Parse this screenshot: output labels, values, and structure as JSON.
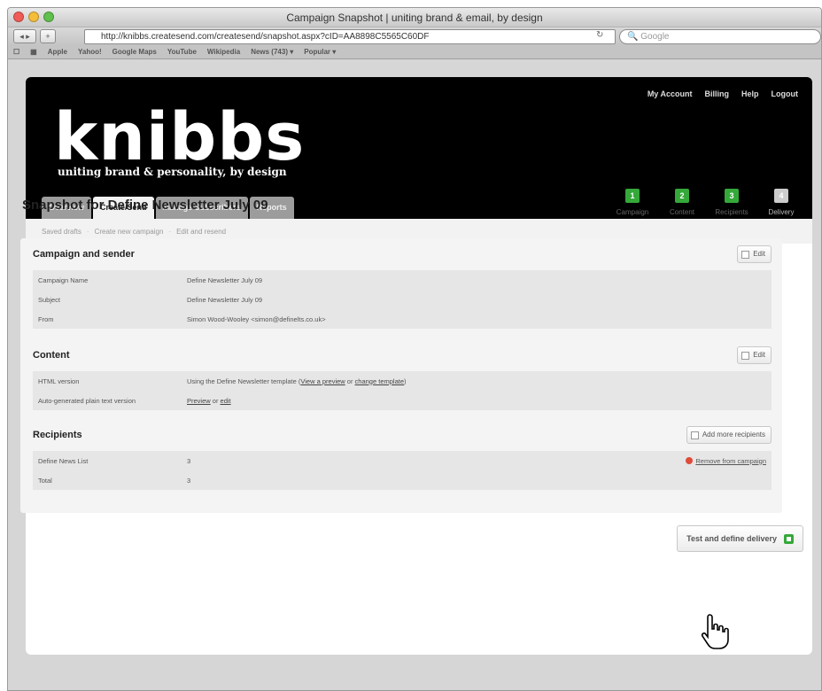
{
  "browser": {
    "window_title": "Campaign Snapshot | uniting brand & email, by design",
    "url": "http://knibbs.createsend.com/createsend/snapshot.aspx?cID=AA8898C5565C60DF",
    "search_placeholder": "Google",
    "bookmarks": [
      "Apple",
      "Yahoo!",
      "Google Maps",
      "YouTube",
      "Wikipedia",
      "News (743) ▾",
      "Popular ▾"
    ]
  },
  "header": {
    "logo": "knibbs",
    "tagline": "uniting brand & personality, by design",
    "links": [
      "My Account",
      "Billing",
      "Help",
      "Logout"
    ],
    "tabs": [
      {
        "label": "Overview",
        "active": false
      },
      {
        "label": "Create/Send",
        "active": true
      },
      {
        "label": "Manage Subscribers",
        "active": false
      },
      {
        "label": "Reports",
        "active": false
      }
    ]
  },
  "breadcrumb": [
    "Saved drafts",
    "Create new campaign",
    "Edit and resend"
  ],
  "page_title": "Snapshot for Define Newsletter July 09",
  "steps": [
    {
      "num": "1",
      "label": "Campaign",
      "done": true
    },
    {
      "num": "2",
      "label": "Content",
      "done": true
    },
    {
      "num": "3",
      "label": "Recipients",
      "done": true
    },
    {
      "num": "4",
      "label": "Delivery",
      "done": false
    }
  ],
  "campaign_section": {
    "title": "Campaign and sender",
    "edit_label": "Edit",
    "rows": [
      {
        "k": "Campaign Name",
        "v": "Define Newsletter July 09"
      },
      {
        "k": "Subject",
        "v": "Define Newsletter July 09"
      },
      {
        "k": "From",
        "v": "Simon Wood-Wooley <simon@definelts.co.uk>"
      }
    ]
  },
  "content_section": {
    "title": "Content",
    "edit_label": "Edit",
    "html_label": "HTML version",
    "html_text": "Using the Define Newsletter template (",
    "html_link1": "View a preview",
    "html_or": " or ",
    "html_link2": "change template",
    "html_close": ")",
    "plain_label": "Auto-generated plain text version",
    "plain_link1": "Preview",
    "plain_or": " or ",
    "plain_link2": "edit"
  },
  "recipients_section": {
    "title": "Recipients",
    "add_label": "Add more recipients",
    "rows": [
      {
        "k": "Define News List",
        "v": "3"
      },
      {
        "k": "Total",
        "v": "3"
      }
    ],
    "remove_label": "Remove from campaign"
  },
  "test_button": "Test and define delivery"
}
